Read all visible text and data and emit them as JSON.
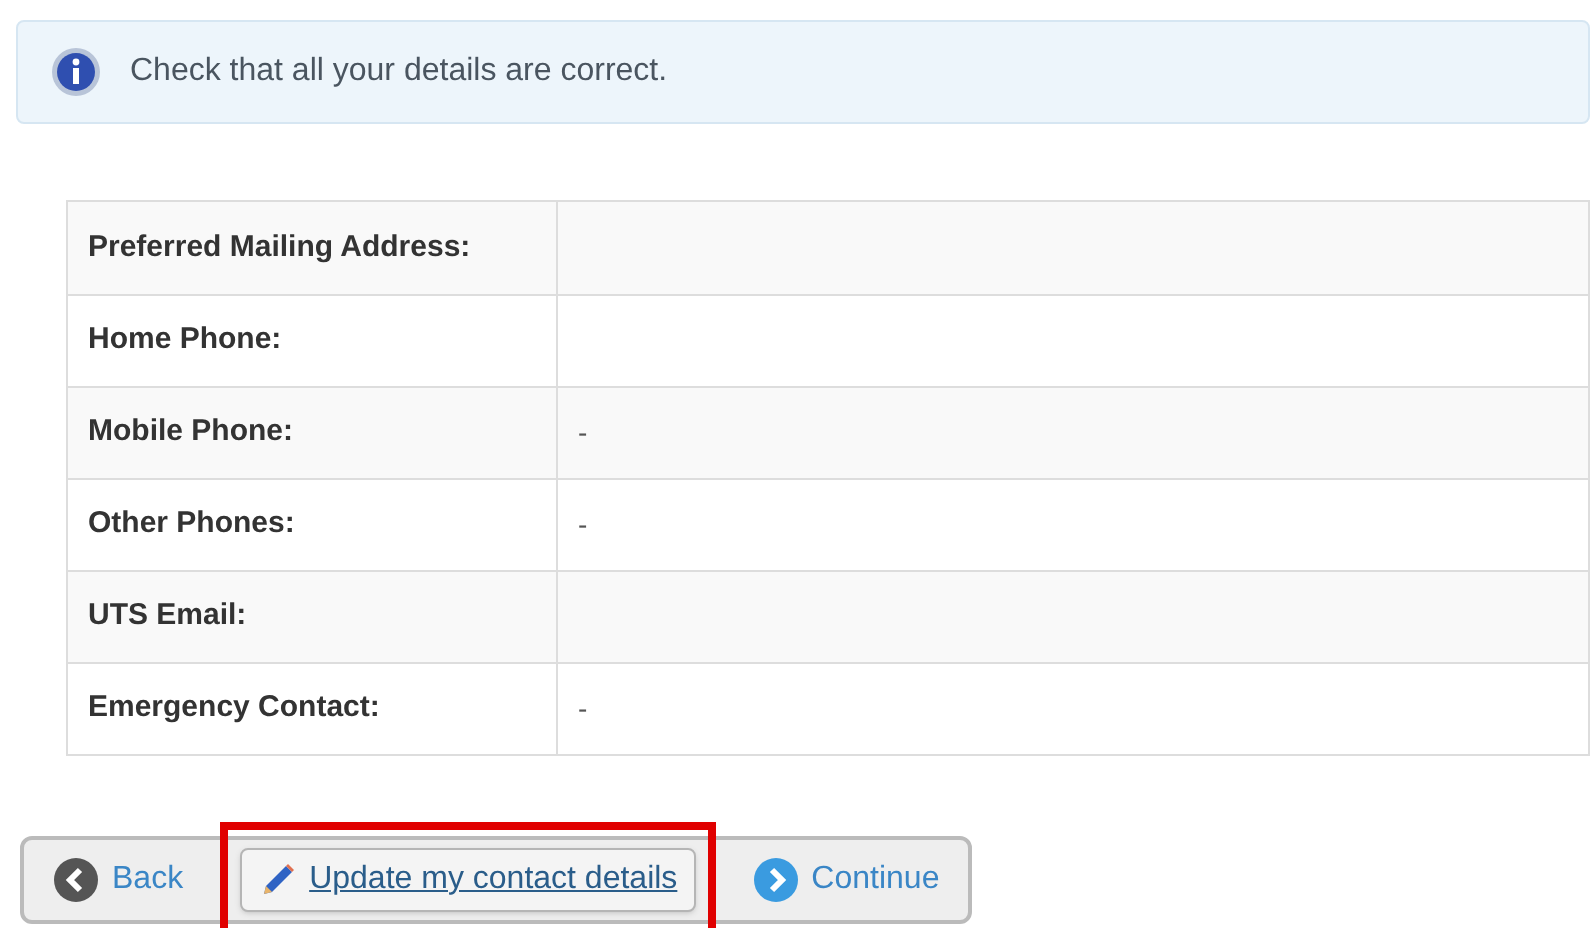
{
  "notice": {
    "text": "Check that all your details are correct."
  },
  "details": [
    {
      "label": "Preferred Mailing Address:"
    },
    {
      "label": "Home Phone:"
    },
    {
      "label": "Mobile Phone:",
      "value": "-"
    },
    {
      "label": "Other Phones:",
      "value": "-"
    },
    {
      "label": "UTS Email:"
    },
    {
      "label": "Emergency Contact:",
      "value": "-"
    }
  ],
  "buttons": [
    {
      "kind": "back",
      "label": "Back",
      "highlighted": false
    },
    {
      "kind": "edit",
      "label": "Update my contact details",
      "highlighted": true
    },
    {
      "kind": "continue",
      "label": "Continue",
      "highlighted": false
    }
  ]
}
